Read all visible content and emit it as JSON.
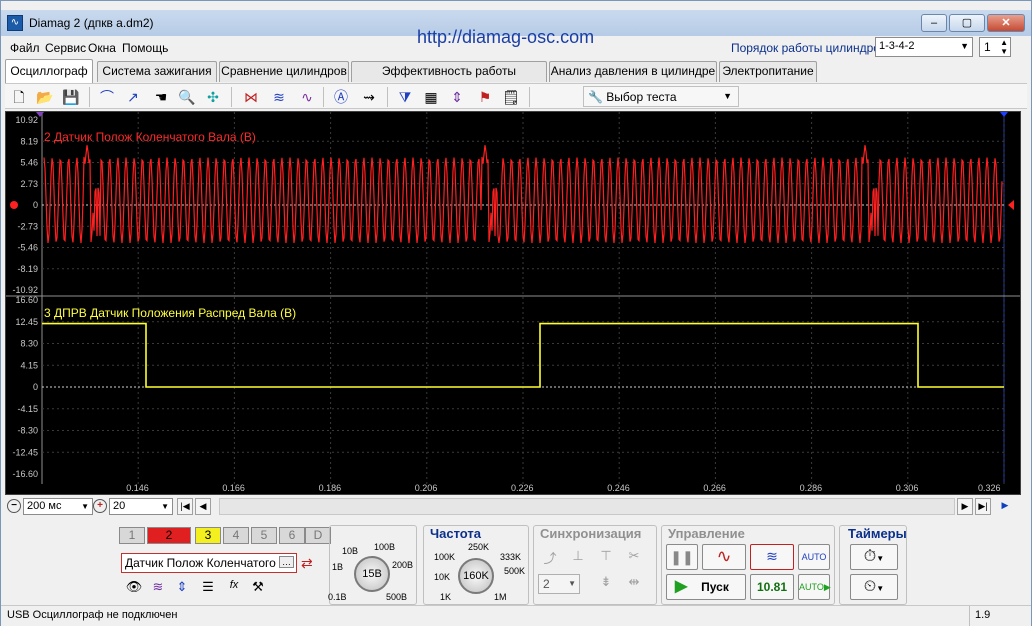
{
  "window": {
    "title": "Diamag 2 (дпкв a.dm2)",
    "app_icon": "waveform-icon"
  },
  "url": "http://diamag-osc.com",
  "menu": [
    "Файл",
    "Сервис",
    "Окна",
    "Помощь"
  ],
  "cylinders": {
    "label": "Порядок работы цилиндров",
    "order": "1-3-4-2",
    "count": "1"
  },
  "tabs": [
    "Осциллограф",
    "Система зажигания",
    "Сравнение цилиндров",
    "Эффективность работы цилиндров",
    "Анализ давления в цилиндре",
    "Электропитание"
  ],
  "toolbar": {
    "test_select": "Выбор теста"
  },
  "channel1": {
    "label": "2 Датчик Полож Коленчатого Вала (В)",
    "color": "#ff2020",
    "ticks": [
      "10.92",
      "8.19",
      "5.46",
      "2.73",
      "0",
      "-2.73",
      "-5.46",
      "-8.19",
      "-10.92"
    ]
  },
  "channel2": {
    "label": "3 ДПРВ Датчик Положения Распред Вала (В)",
    "color": "#ffff30",
    "ticks": [
      "16.60",
      "12.45",
      "8.30",
      "4.15",
      "0",
      "-4.15",
      "-8.30",
      "-12.45",
      "-16.60"
    ]
  },
  "time_ticks": [
    "0.146",
    "0.166",
    "0.186",
    "0.206",
    "0.226",
    "0.246",
    "0.266",
    "0.286",
    "0.306",
    "0.326"
  ],
  "scroll": {
    "timebase": "200 мс",
    "count": "20"
  },
  "channels_buttons": [
    "1",
    "2",
    "3",
    "4",
    "5",
    "6",
    "D"
  ],
  "sensor": {
    "name": "Датчик Полож Коленчатого Ва"
  },
  "voltage": {
    "title": "",
    "value": "15В",
    "labels": [
      "10В",
      "100В",
      "1В",
      "200В",
      "0.1В",
      "500В"
    ]
  },
  "frequency": {
    "title": "Частота",
    "value": "160K",
    "labels": [
      "250K",
      "100K",
      "333K",
      "10K",
      "500K",
      "1K",
      "1M"
    ]
  },
  "sync": {
    "title": "Синхронизация",
    "value": "2"
  },
  "control": {
    "title": "Управление",
    "start": "Пуск",
    "readout": "10.81"
  },
  "timers": {
    "title": "Таймеры"
  },
  "status": {
    "left": "USB Осциллограф не подключен",
    "right": "1.9"
  }
}
